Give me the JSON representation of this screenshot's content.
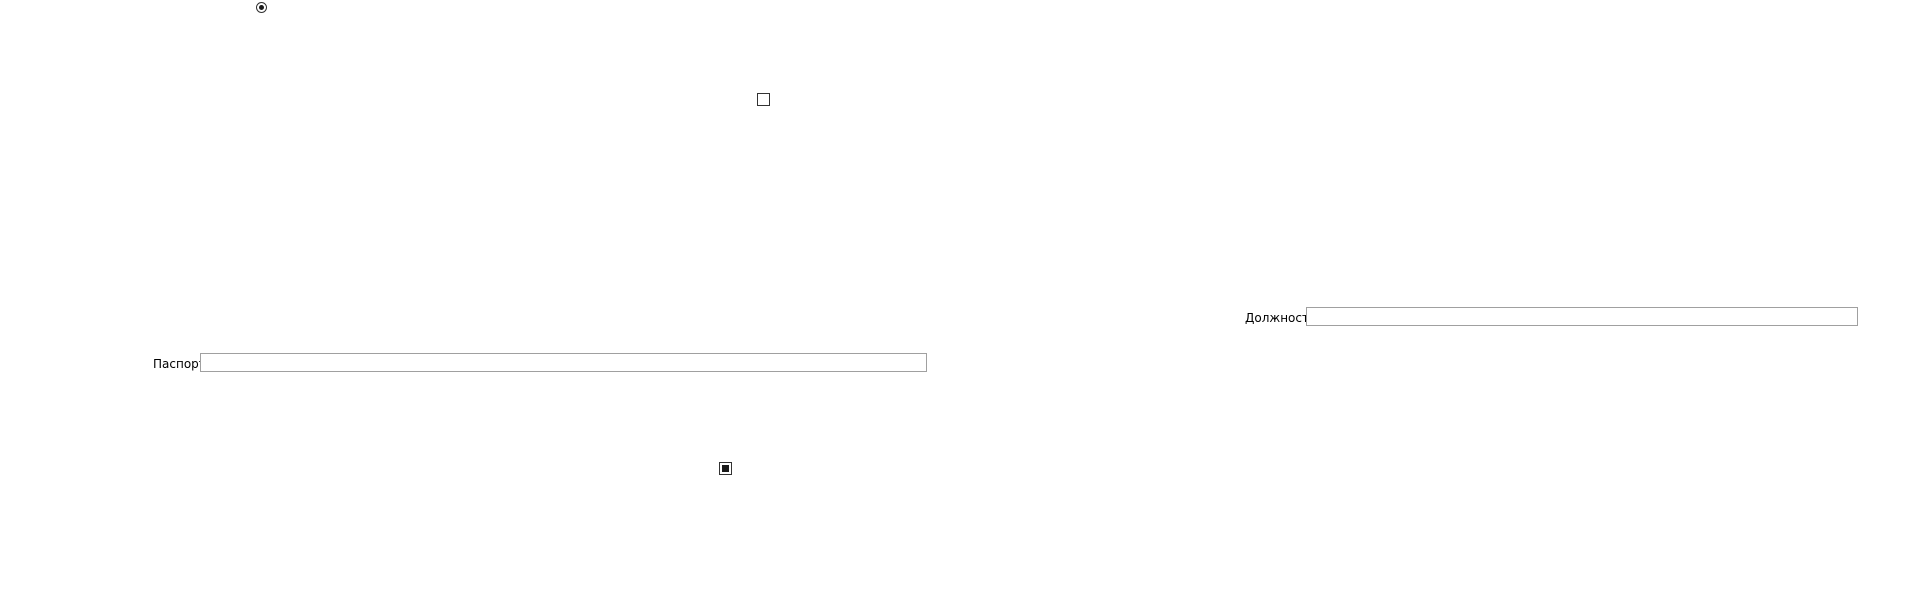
{
  "form": {
    "radio": {
      "checked": true
    },
    "checkbox_unchecked": {
      "checked": false
    },
    "checkbox_indeterminate": {
      "state": "indeterminate"
    },
    "position_field": {
      "label": "Должность",
      "value": "",
      "placeholder": ""
    },
    "passport_field": {
      "label": "Паспорт",
      "value": "",
      "placeholder": ""
    }
  },
  "colors": {
    "background": "#ffffff",
    "border": "#a0a0a0",
    "control_border": "#333333",
    "mark": "#1a1a1a"
  }
}
